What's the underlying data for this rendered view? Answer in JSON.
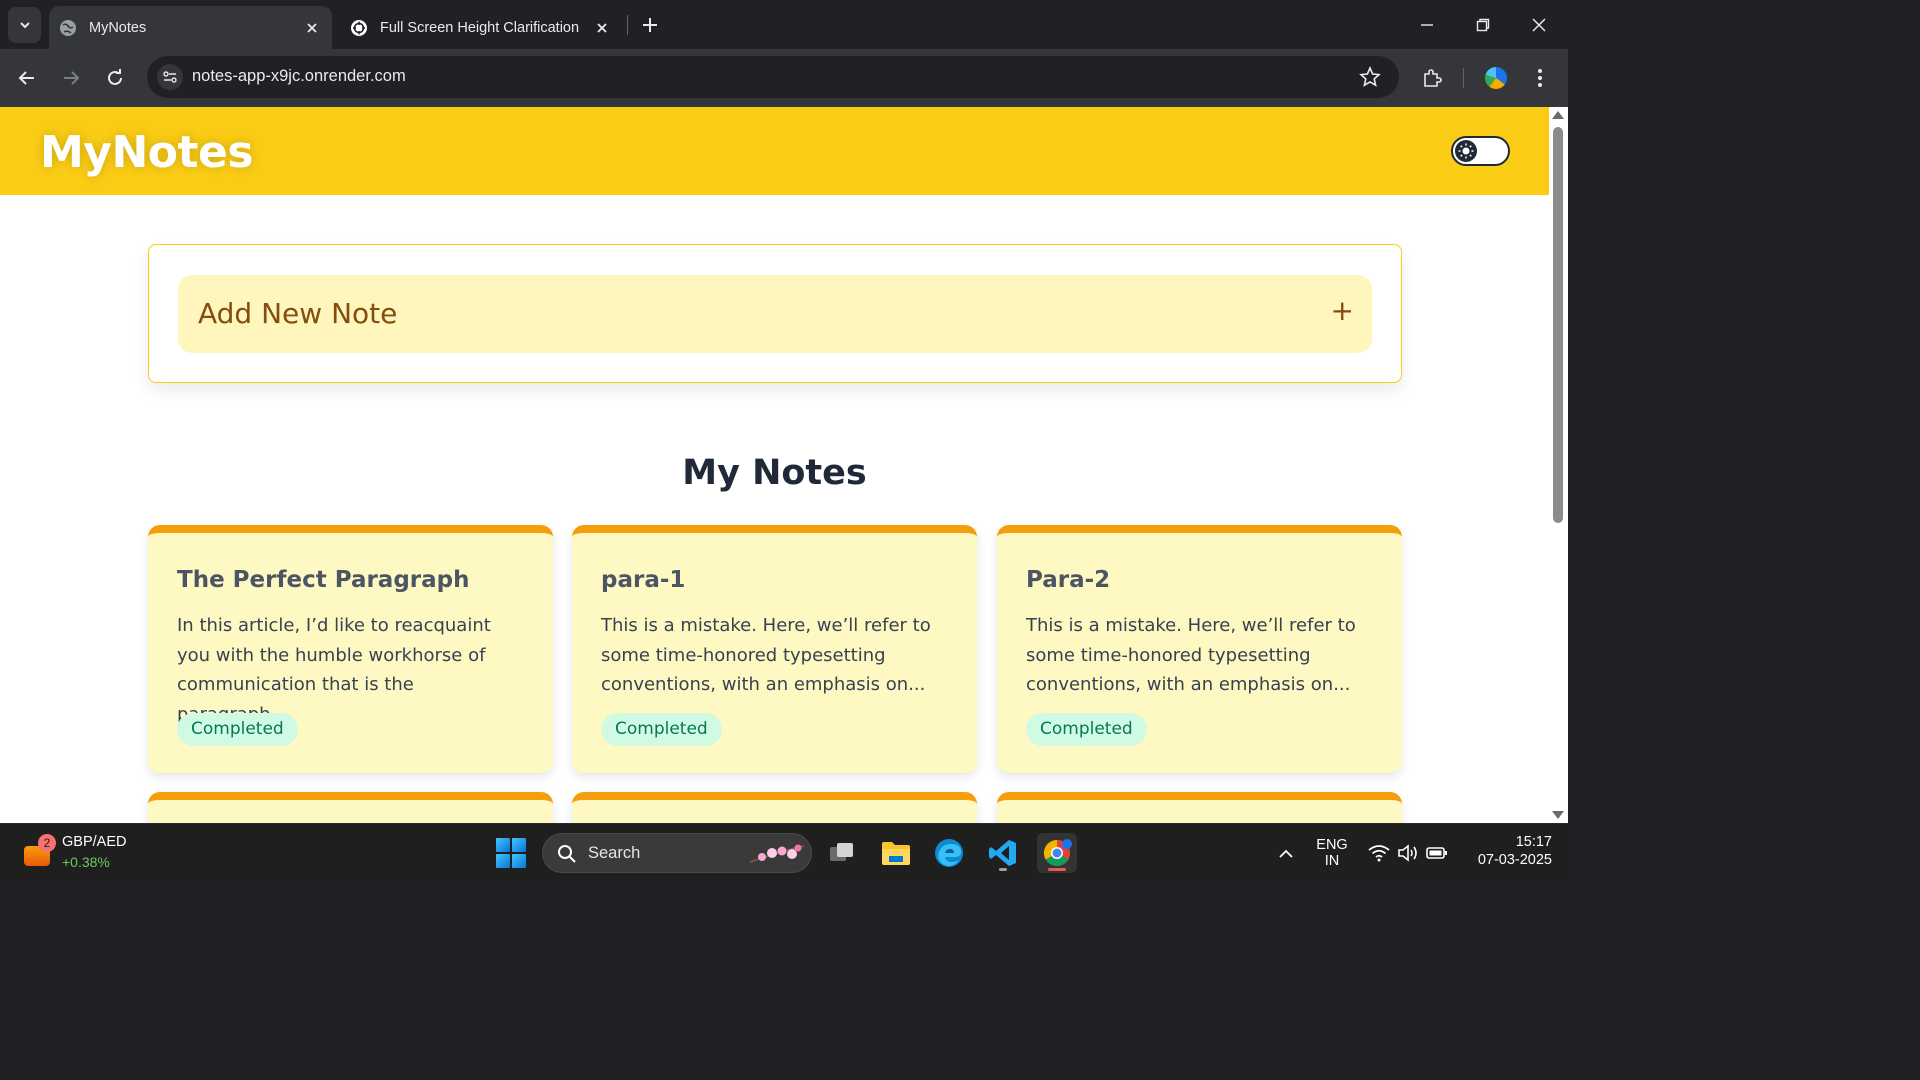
{
  "browser": {
    "tabs": [
      {
        "title": "MyNotes",
        "active": true
      },
      {
        "title": "Full Screen Height Clarification",
        "active": false
      }
    ],
    "url": "notes-app-x9jc.onrender.com"
  },
  "app": {
    "brand": "MyNotes",
    "add_note_label": "Add New Note",
    "add_note_icon": "+",
    "section_title": "My Notes",
    "notes": [
      {
        "title": "The Perfect Paragraph",
        "body": "In this article, I’d like to reacquaint you with the humble workhorse of communication that is the paragraph....",
        "status": "Completed"
      },
      {
        "title": "para-1",
        "body": "This is a mistake. Here, we’ll refer to some time-honored typesetting conventions, with an emphasis on...",
        "status": "Completed"
      },
      {
        "title": "Para-2",
        "body": "This is a mistake. Here, we’ll refer to some time-honored typesetting conventions, with an emphasis on...",
        "status": "Completed"
      }
    ]
  },
  "taskbar": {
    "widget_badge": "2",
    "widget_pair": "GBP/AED",
    "widget_change": "+0.38%",
    "search_label": "Search",
    "lang_line1": "ENG",
    "lang_line2": "IN",
    "time": "15:17",
    "date": "07-03-2025"
  },
  "colors": {
    "header": "#facc15",
    "note_bg": "#fef9c3",
    "note_accent": "#f59e0b",
    "status_bg": "#d1fae5",
    "status_text": "#047857"
  }
}
